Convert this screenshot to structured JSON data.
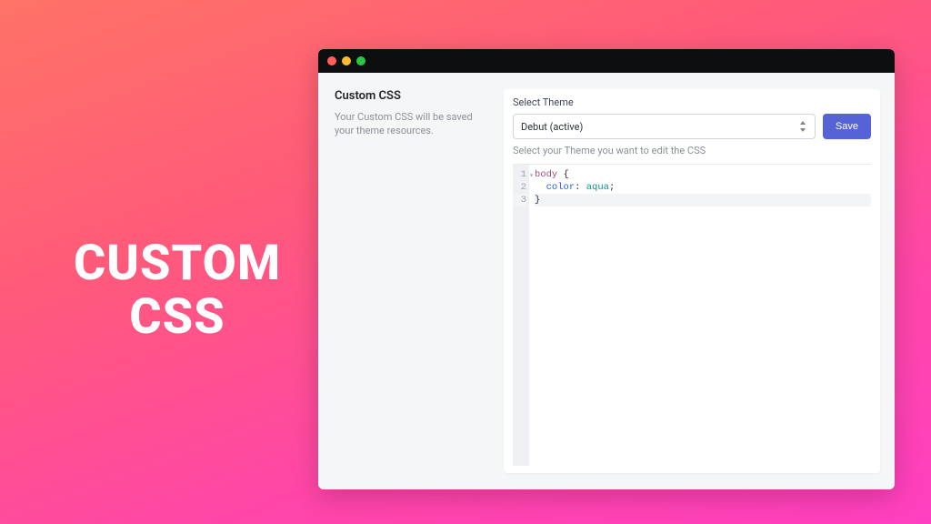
{
  "hero": {
    "line1": "CUSTOM",
    "line2": "CSS"
  },
  "section": {
    "title": "Custom CSS",
    "subtitle": "Your Custom CSS will be saved your theme resources."
  },
  "theme": {
    "label": "Select Theme",
    "selected": "Debut (active)",
    "helper": "Select your Theme you want to edit the CSS"
  },
  "buttons": {
    "save": "Save"
  },
  "editor": {
    "lines": [
      {
        "num": "1",
        "text": "body {"
      },
      {
        "num": "2",
        "text": "  color: aqua;"
      },
      {
        "num": "3",
        "text": "}"
      }
    ],
    "tokens": {
      "selector": "body",
      "brace_open": " {",
      "indent": "  ",
      "property": "color",
      "colon": ": ",
      "value": "aqua",
      "semicolon": ";",
      "brace_close": "}"
    }
  }
}
